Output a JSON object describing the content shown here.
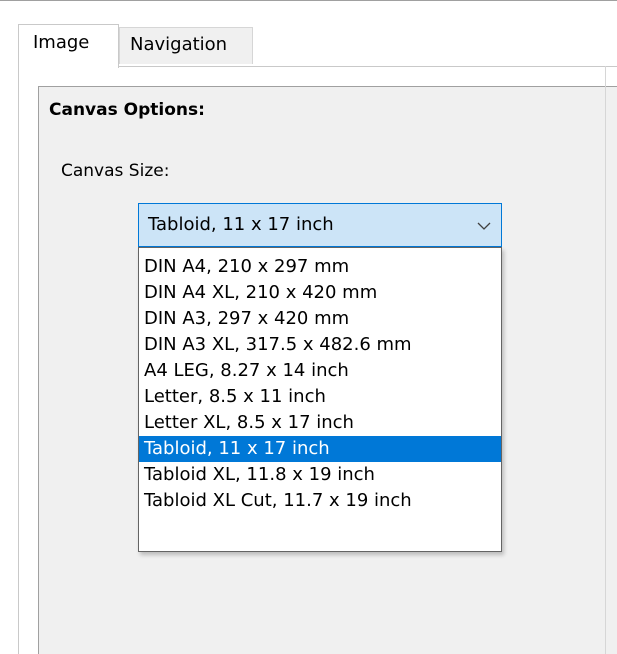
{
  "tabs": [
    {
      "label": "Image",
      "active": true
    },
    {
      "label": "Navigation",
      "active": false
    }
  ],
  "panel": {
    "section_title": "Canvas Options:",
    "canvas_size_label": "Canvas Size:"
  },
  "canvas_size": {
    "selected": "Tabloid, 11 x 17 inch",
    "icon": "chevron-down-icon",
    "options": [
      "DIN A4, 210 x 297 mm",
      "DIN A4 XL, 210 x 420 mm",
      "DIN A3, 297 x 420 mm",
      "DIN A3 XL, 317.5 x 482.6 mm",
      "A4 LEG, 8.27 x 14 inch",
      "Letter, 8.5 x 11 inch",
      "Letter XL, 8.5 x 17 inch",
      "Tabloid, 11 x 17 inch",
      "Tabloid XL, 11.8 x 19 inch",
      "Tabloid XL Cut, 11.7 x 19 inch"
    ],
    "selected_index": 7
  },
  "colors": {
    "accent": "#0078d7",
    "combo_background": "#cce4f7",
    "panel_background": "#f0f0f0"
  }
}
